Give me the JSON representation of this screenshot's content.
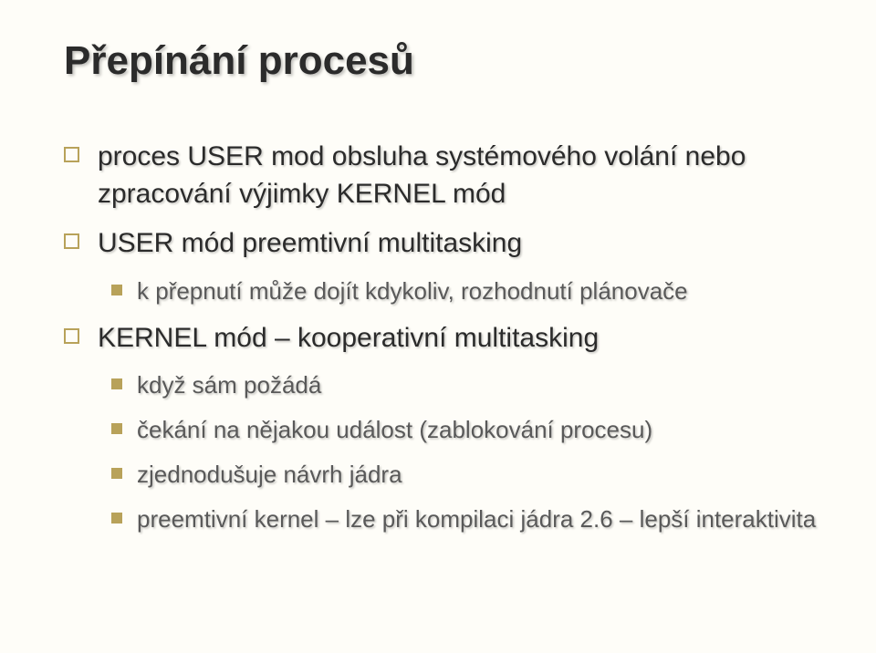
{
  "title": "Přepínání procesů",
  "bullets": {
    "l1a": "proces USER mod obsluha systémového volání nebo zpracování výjimky KERNEL mód",
    "l1b": "USER mód preemtivní multitasking",
    "l2a": "k přepnutí může dojít kdykoliv, rozhodnutí plánovače",
    "l1c": "KERNEL mód – kooperativní multitasking",
    "l2b": "když sám požádá",
    "l2c": "čekání na nějakou událost (zablokování procesu)",
    "l2d": "zjednodušuje návrh jádra",
    "l2e": "preemtivní kernel – lze při kompilaci jádra 2.6 – lepší interaktivita"
  }
}
